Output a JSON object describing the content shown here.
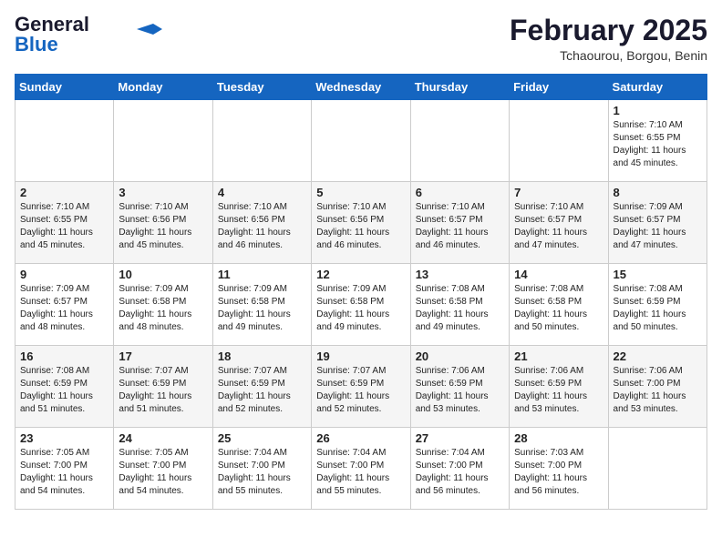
{
  "header": {
    "logo_line1": "General",
    "logo_line2": "Blue",
    "month_year": "February 2025",
    "location": "Tchaourou, Borgou, Benin"
  },
  "weekdays": [
    "Sunday",
    "Monday",
    "Tuesday",
    "Wednesday",
    "Thursday",
    "Friday",
    "Saturday"
  ],
  "weeks": [
    [
      {
        "day": "",
        "info": ""
      },
      {
        "day": "",
        "info": ""
      },
      {
        "day": "",
        "info": ""
      },
      {
        "day": "",
        "info": ""
      },
      {
        "day": "",
        "info": ""
      },
      {
        "day": "",
        "info": ""
      },
      {
        "day": "1",
        "info": "Sunrise: 7:10 AM\nSunset: 6:55 PM\nDaylight: 11 hours\nand 45 minutes."
      }
    ],
    [
      {
        "day": "2",
        "info": "Sunrise: 7:10 AM\nSunset: 6:55 PM\nDaylight: 11 hours\nand 45 minutes."
      },
      {
        "day": "3",
        "info": "Sunrise: 7:10 AM\nSunset: 6:56 PM\nDaylight: 11 hours\nand 45 minutes."
      },
      {
        "day": "4",
        "info": "Sunrise: 7:10 AM\nSunset: 6:56 PM\nDaylight: 11 hours\nand 46 minutes."
      },
      {
        "day": "5",
        "info": "Sunrise: 7:10 AM\nSunset: 6:56 PM\nDaylight: 11 hours\nand 46 minutes."
      },
      {
        "day": "6",
        "info": "Sunrise: 7:10 AM\nSunset: 6:57 PM\nDaylight: 11 hours\nand 46 minutes."
      },
      {
        "day": "7",
        "info": "Sunrise: 7:10 AM\nSunset: 6:57 PM\nDaylight: 11 hours\nand 47 minutes."
      },
      {
        "day": "8",
        "info": "Sunrise: 7:09 AM\nSunset: 6:57 PM\nDaylight: 11 hours\nand 47 minutes."
      }
    ],
    [
      {
        "day": "9",
        "info": "Sunrise: 7:09 AM\nSunset: 6:57 PM\nDaylight: 11 hours\nand 48 minutes."
      },
      {
        "day": "10",
        "info": "Sunrise: 7:09 AM\nSunset: 6:58 PM\nDaylight: 11 hours\nand 48 minutes."
      },
      {
        "day": "11",
        "info": "Sunrise: 7:09 AM\nSunset: 6:58 PM\nDaylight: 11 hours\nand 49 minutes."
      },
      {
        "day": "12",
        "info": "Sunrise: 7:09 AM\nSunset: 6:58 PM\nDaylight: 11 hours\nand 49 minutes."
      },
      {
        "day": "13",
        "info": "Sunrise: 7:08 AM\nSunset: 6:58 PM\nDaylight: 11 hours\nand 49 minutes."
      },
      {
        "day": "14",
        "info": "Sunrise: 7:08 AM\nSunset: 6:58 PM\nDaylight: 11 hours\nand 50 minutes."
      },
      {
        "day": "15",
        "info": "Sunrise: 7:08 AM\nSunset: 6:59 PM\nDaylight: 11 hours\nand 50 minutes."
      }
    ],
    [
      {
        "day": "16",
        "info": "Sunrise: 7:08 AM\nSunset: 6:59 PM\nDaylight: 11 hours\nand 51 minutes."
      },
      {
        "day": "17",
        "info": "Sunrise: 7:07 AM\nSunset: 6:59 PM\nDaylight: 11 hours\nand 51 minutes."
      },
      {
        "day": "18",
        "info": "Sunrise: 7:07 AM\nSunset: 6:59 PM\nDaylight: 11 hours\nand 52 minutes."
      },
      {
        "day": "19",
        "info": "Sunrise: 7:07 AM\nSunset: 6:59 PM\nDaylight: 11 hours\nand 52 minutes."
      },
      {
        "day": "20",
        "info": "Sunrise: 7:06 AM\nSunset: 6:59 PM\nDaylight: 11 hours\nand 53 minutes."
      },
      {
        "day": "21",
        "info": "Sunrise: 7:06 AM\nSunset: 6:59 PM\nDaylight: 11 hours\nand 53 minutes."
      },
      {
        "day": "22",
        "info": "Sunrise: 7:06 AM\nSunset: 7:00 PM\nDaylight: 11 hours\nand 53 minutes."
      }
    ],
    [
      {
        "day": "23",
        "info": "Sunrise: 7:05 AM\nSunset: 7:00 PM\nDaylight: 11 hours\nand 54 minutes."
      },
      {
        "day": "24",
        "info": "Sunrise: 7:05 AM\nSunset: 7:00 PM\nDaylight: 11 hours\nand 54 minutes."
      },
      {
        "day": "25",
        "info": "Sunrise: 7:04 AM\nSunset: 7:00 PM\nDaylight: 11 hours\nand 55 minutes."
      },
      {
        "day": "26",
        "info": "Sunrise: 7:04 AM\nSunset: 7:00 PM\nDaylight: 11 hours\nand 55 minutes."
      },
      {
        "day": "27",
        "info": "Sunrise: 7:04 AM\nSunset: 7:00 PM\nDaylight: 11 hours\nand 56 minutes."
      },
      {
        "day": "28",
        "info": "Sunrise: 7:03 AM\nSunset: 7:00 PM\nDaylight: 11 hours\nand 56 minutes."
      },
      {
        "day": "",
        "info": ""
      }
    ]
  ]
}
